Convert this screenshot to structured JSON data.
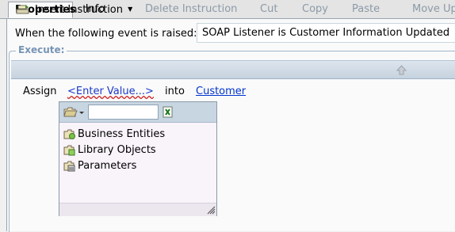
{
  "tabs": [
    {
      "label": "Properties",
      "active": true
    },
    {
      "label": "Info",
      "active": false
    }
  ],
  "event": {
    "label": "When the following event is raised:",
    "value": "SOAP Listener is Customer Information Updated"
  },
  "execute": {
    "legend": "Execute:"
  },
  "toolbar": {
    "insert_label": "Insert Instruction",
    "delete_label": "Delete Instruction",
    "cut_label": "Cut",
    "copy_label": "Copy",
    "paste_label": "Paste",
    "moveup_label": "Move Up"
  },
  "instruction": {
    "assign_label": "Assign",
    "value_placeholder": "<Enter Value...>",
    "into_label": "into",
    "target_label": "Customer"
  },
  "picker": {
    "search_value": "",
    "items": [
      {
        "label": "Business Entities",
        "icon": "business-entities-icon"
      },
      {
        "label": "Library Objects",
        "icon": "library-objects-icon"
      },
      {
        "label": "Parameters",
        "icon": "parameters-icon"
      }
    ]
  },
  "colors": {
    "legend": "#7794b5",
    "link": "#0033cc",
    "disabled_text": "#8c9aa8",
    "toolbar_top": "#dde5ee",
    "toolbar_bottom": "#c5d2de",
    "popup_bg": "#f9f3fa"
  }
}
